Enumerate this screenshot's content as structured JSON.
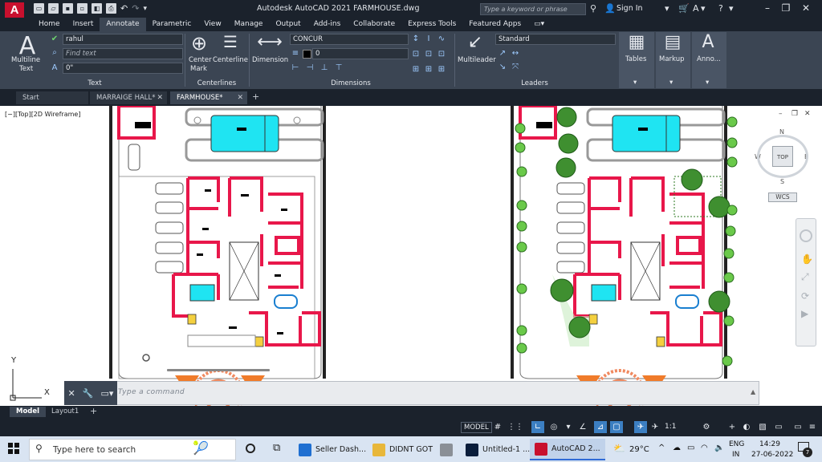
{
  "window": {
    "title": "Autodesk AutoCAD 2021   FARMHOUSE.dwg",
    "search_placeholder": "Type a keyword or phrase",
    "sign_in": "Sign In"
  },
  "menu_tabs": [
    "Home",
    "Insert",
    "Annotate",
    "Parametric",
    "View",
    "Manage",
    "Output",
    "Add-ins",
    "Collaborate",
    "Express Tools",
    "Featured Apps"
  ],
  "active_menu_tab": "Annotate",
  "ribbon": {
    "text_panel": {
      "label": "Text",
      "multiline_text_1": "Multiline",
      "multiline_text_2": "Text",
      "text_style": "rahul",
      "find_text_placeholder": "Find text",
      "text_height": "0\""
    },
    "centerlines_panel": {
      "label": "Centerlines",
      "center_mark_1": "Center",
      "center_mark_2": "Mark",
      "centerline": "Centerline"
    },
    "dimensions_panel": {
      "label": "Dimensions",
      "dimension": "Dimension",
      "dim_style": "CONCUR",
      "dim_layer_value": "0"
    },
    "leaders_panel": {
      "label": "Leaders",
      "multileader": "Multileader",
      "leader_style": "Standard"
    },
    "tables_label": "Tables",
    "markup_label": "Markup",
    "annotation_label": "Anno..."
  },
  "file_tabs": [
    {
      "label": "Start",
      "closable": false,
      "active": false
    },
    {
      "label": "MARRAIGE HALL*",
      "closable": true,
      "active": false
    },
    {
      "label": "FARMHOUSE*",
      "closable": true,
      "active": true
    }
  ],
  "viewport": {
    "view_label": "[−][Top][2D Wireframe]",
    "viewcube_top": "TOP",
    "compass_n": "N",
    "compass_w": "W",
    "compass_e": "E",
    "compass_s": "S",
    "wcs": "WCS",
    "ucs_y": "Y",
    "ucs_x": "X"
  },
  "command_line": {
    "placeholder": "Type a command"
  },
  "layout_tabs": [
    {
      "label": "Model",
      "active": true
    },
    {
      "label": "Layout1",
      "active": false
    }
  ],
  "status_bar": {
    "model": "MODEL",
    "scale": "1:1"
  },
  "taskbar": {
    "search_placeholder": "Type here to search",
    "apps": [
      {
        "label": "Seller Dash...",
        "icon": "edge-icon",
        "color": "#1f6fd1"
      },
      {
        "label": "DIDNT GOT",
        "icon": "folder-icon",
        "color": "#e8b73a"
      },
      {
        "label": "",
        "icon": "drive-icon",
        "color": "#8a8f96"
      },
      {
        "label": "Untitled-1 ...",
        "icon": "photoshop-icon",
        "color": "#0a1d3b"
      },
      {
        "label": "AutoCAD 2...",
        "icon": "autocad-icon",
        "color": "#c8102e"
      }
    ],
    "weather": "29°C",
    "language_1": "ENG",
    "language_2": "IN",
    "time": "14:29",
    "date": "27-06-2022",
    "notifications": "7"
  },
  "colors": {
    "wall_red": "#e8174a",
    "pool_cyan": "#1fe4f2",
    "tree_green": "#3a8a2a",
    "ribbon_bg": "#3b4553",
    "dark_bg": "#1b222c"
  }
}
